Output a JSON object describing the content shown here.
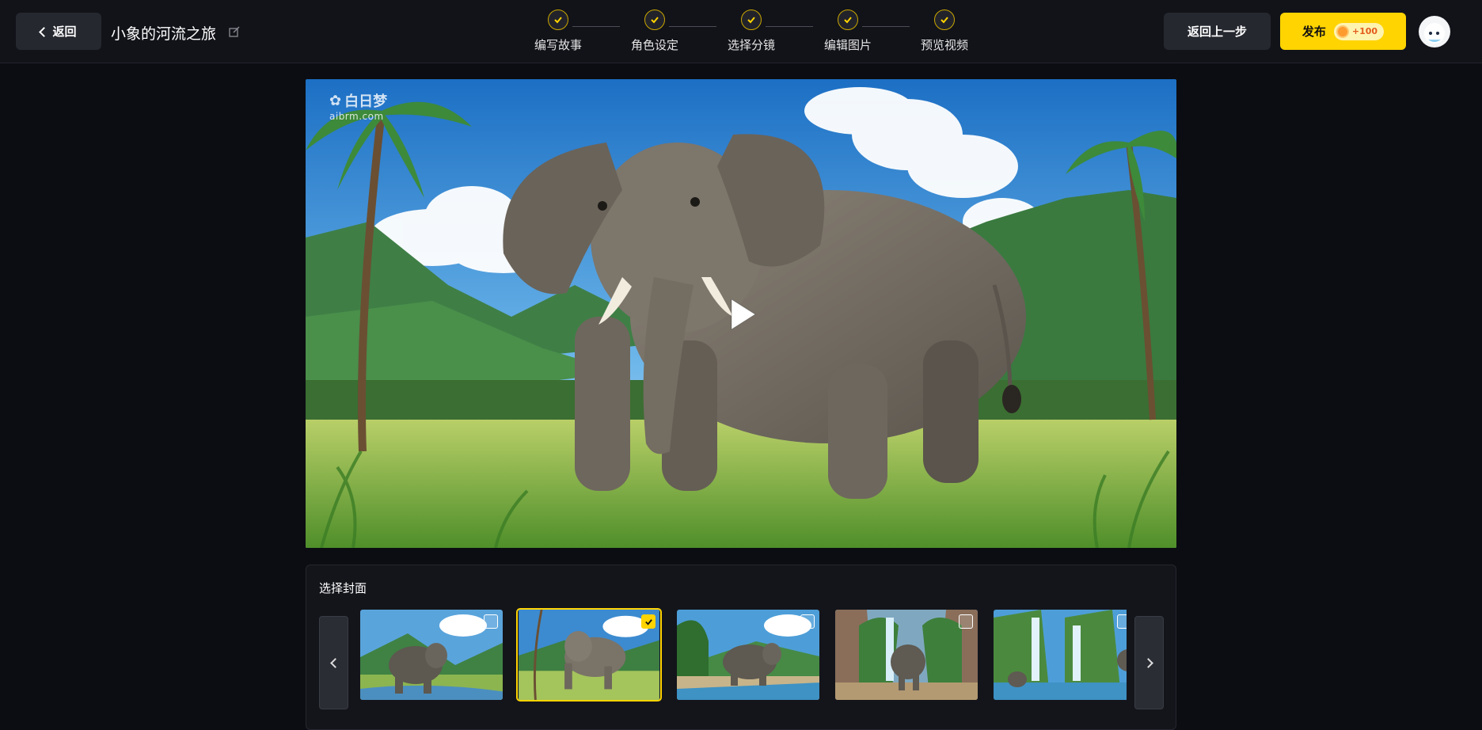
{
  "header": {
    "back_label": "返回",
    "project_title": "小象的河流之旅",
    "prev_step_label": "返回上一步",
    "publish_label": "发布",
    "publish_credit": "+100"
  },
  "steps": [
    {
      "label": "编写故事",
      "done": true
    },
    {
      "label": "角色设定",
      "done": true
    },
    {
      "label": "选择分镜",
      "done": true
    },
    {
      "label": "编辑图片",
      "done": true
    },
    {
      "label": "预览视频",
      "done": true
    }
  ],
  "watermark": {
    "brand": "白日梦",
    "site": "aibrm.com"
  },
  "cover": {
    "title": "选择封面",
    "thumbnails": [
      {
        "scene": "elephant-by-stream",
        "selected": false
      },
      {
        "scene": "elephant-in-meadow",
        "selected": true
      },
      {
        "scene": "elephant-at-riverbank",
        "selected": false
      },
      {
        "scene": "elephant-at-waterfall-path",
        "selected": false
      },
      {
        "scene": "calf-at-waterfalls",
        "selected": false
      }
    ]
  },
  "colors": {
    "accent": "#ffd400",
    "background": "#0c0d12",
    "header_bg": "#121319",
    "button_bg": "#262830"
  }
}
